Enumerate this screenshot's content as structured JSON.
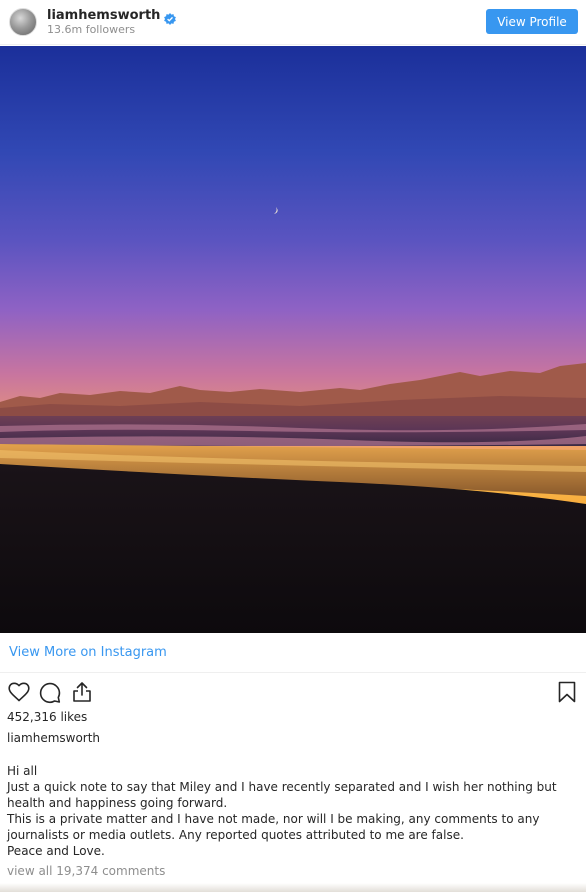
{
  "header": {
    "username": "liamhemsworth",
    "followers": "13.6m followers",
    "view_profile_label": "View Profile"
  },
  "colors": {
    "accent": "#3897f0",
    "text": "#262626",
    "muted": "#8e8e8e"
  },
  "icons": {
    "verified": "verified-badge-icon",
    "like": "heart-icon",
    "comment": "comment-icon",
    "share": "share-icon",
    "save": "bookmark-icon"
  },
  "post": {
    "view_more_label": "View More on Instagram",
    "likes": "452,316 likes",
    "caption_user": "liamhemsworth",
    "caption_lines": [
      "Hi all",
      "Just a quick note to say that Miley and I have recently separated and I wish her nothing but health and happiness going forward.",
      "This is a private matter and I have not made, nor will I be making, any comments to any journalists or media outlets. Any reported quotes attributed to me are false.",
      "Peace and Love."
    ],
    "view_comments": "view all 19,374 comments"
  }
}
